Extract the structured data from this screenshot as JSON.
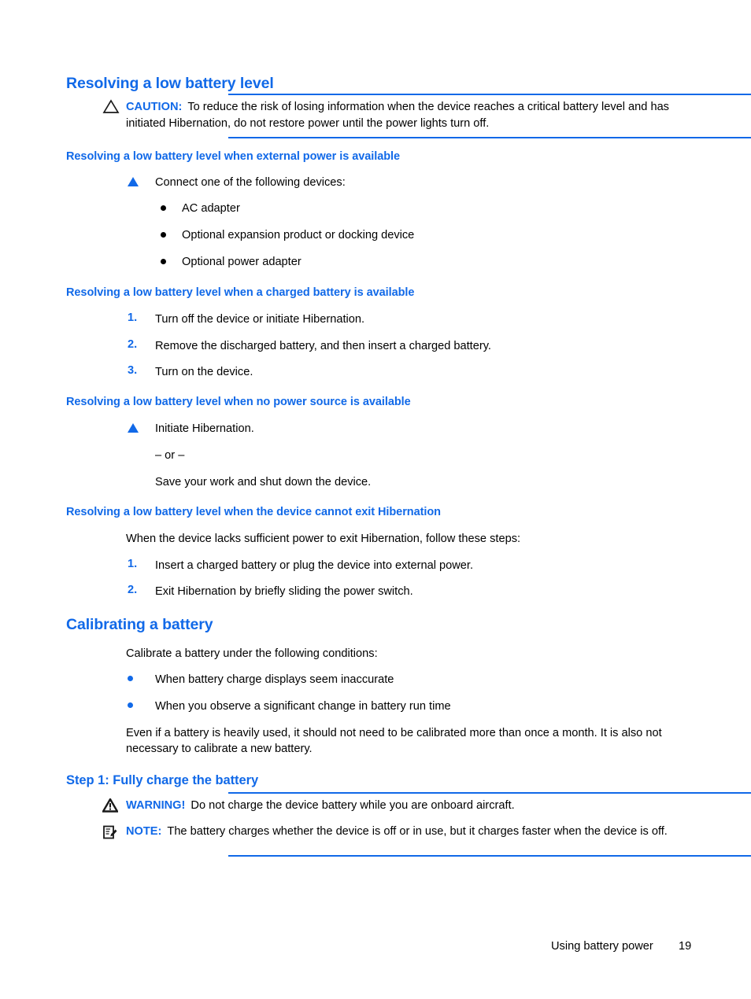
{
  "section1": {
    "heading": "Resolving a low battery level",
    "caution": {
      "icon": "caution-triangle-icon",
      "label": "CAUTION:",
      "text": "To reduce the risk of losing information when the device reaches a critical battery level and has initiated Hibernation, do not restore power until the power lights turn off."
    },
    "sub1": {
      "heading": "Resolving a low battery level when external power is available",
      "lead": "Connect one of the following devices:",
      "bullets": [
        "AC adapter",
        "Optional expansion product or docking device",
        "Optional power adapter"
      ]
    },
    "sub2": {
      "heading": "Resolving a low battery level when a charged battery is available",
      "steps": [
        {
          "num": "1.",
          "text": "Turn off the device or initiate Hibernation."
        },
        {
          "num": "2.",
          "text": "Remove the discharged battery, and then insert a charged battery."
        },
        {
          "num": "3.",
          "text": "Turn on the device."
        }
      ]
    },
    "sub3": {
      "heading": "Resolving a low battery level when no power source is available",
      "option1": "Initiate Hibernation.",
      "separator": "– or –",
      "option2": "Save your work and shut down the device."
    },
    "sub4": {
      "heading": "Resolving a low battery level when the device cannot exit Hibernation",
      "lead": "When the device lacks sufficient power to exit Hibernation, follow these steps:",
      "steps": [
        {
          "num": "1.",
          "text": "Insert a charged battery or plug the device into external power."
        },
        {
          "num": "2.",
          "text": "Exit Hibernation by briefly sliding the power switch."
        }
      ]
    }
  },
  "section2": {
    "heading": "Calibrating a battery",
    "lead": "Calibrate a battery under the following conditions:",
    "bullets": [
      "When battery charge displays seem inaccurate",
      "When you observe a significant change in battery run time"
    ],
    "paragraph": "Even if a battery is heavily used, it should not need to be calibrated more than once a month. It is also not necessary to calibrate a new battery.",
    "step1": {
      "heading": "Step 1: Fully charge the battery",
      "warning": {
        "icon": "warning-triangle-icon",
        "label": "WARNING!",
        "text": "Do not charge the device battery while you are onboard aircraft."
      },
      "note": {
        "icon": "note-pencil-icon",
        "label": "NOTE:",
        "text": "The battery charges whether the device is off or in use, but it charges faster when the device is off."
      }
    }
  },
  "footer": {
    "chapter": "Using battery power",
    "page_number": "19"
  },
  "colors": {
    "accent_blue": "#1169e8",
    "text_black": "#000000",
    "background": "#ffffff"
  }
}
